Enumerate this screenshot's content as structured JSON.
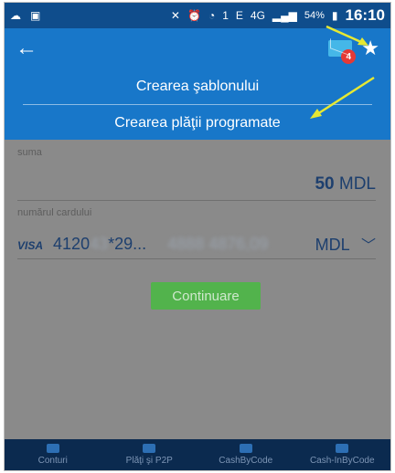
{
  "status_bar": {
    "battery": "54%",
    "time": "16:10",
    "network": "4G",
    "sim": "1",
    "edge": "E"
  },
  "header": {
    "back_icon": "←",
    "mail_badge": "4",
    "star_icon": "★"
  },
  "menu": {
    "items": [
      {
        "label": "Crearea şablonului"
      },
      {
        "label": "Crearea plăţii programate"
      }
    ]
  },
  "form": {
    "sum_label": "suma",
    "sum_value": "50",
    "sum_currency": "MDL",
    "card_label": "numărul cardului",
    "card_brand": "VISA",
    "card_number": "4120",
    "card_number_hidden": "43",
    "card_suffix": "*29...",
    "card_blurred": "4888 4876,09",
    "card_currency": "MDL",
    "continue_label": "Continuare"
  },
  "bottom_nav": {
    "items": [
      {
        "label": "Conturi"
      },
      {
        "label": "Plăţi şi P2P"
      },
      {
        "label": "CashByCode"
      },
      {
        "label": "Cash-InByCode"
      }
    ]
  },
  "colors": {
    "header": "#1877c9",
    "status_bar": "#0f4d8c",
    "button": "#52b34c",
    "bottom_nav": "#0b2a4f",
    "annotation": "#e6e832"
  }
}
